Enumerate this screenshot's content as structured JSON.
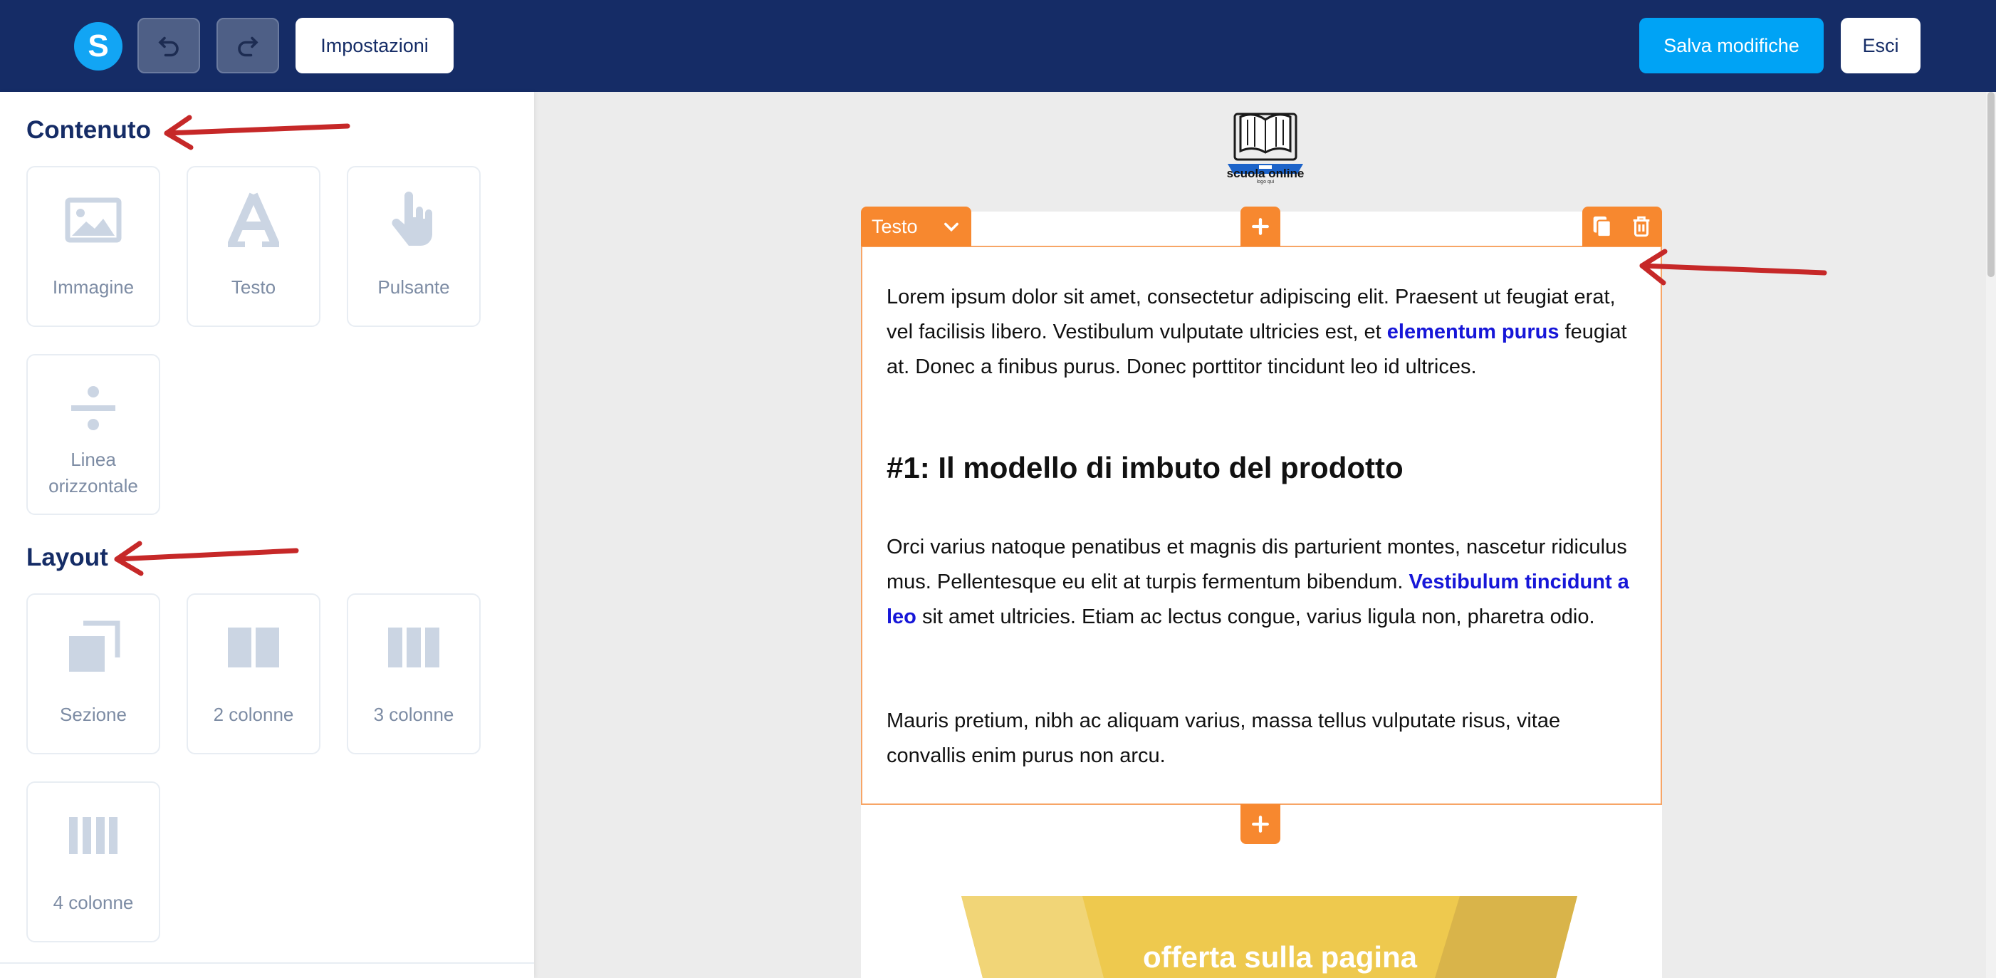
{
  "toolbar": {
    "logo_letter": "S",
    "settings_label": "Impostazioni",
    "save_label": "Salva modifiche",
    "exit_label": "Esci"
  },
  "sidebar": {
    "content_title": "Contenuto",
    "content_items": [
      {
        "label": "Immagine",
        "icon": "image-icon"
      },
      {
        "label": "Testo",
        "icon": "text-icon"
      },
      {
        "label": "Pulsante",
        "icon": "pointer-icon"
      },
      {
        "label_line1": "Linea",
        "label_line2": "orizzontale",
        "icon": "divider-icon"
      }
    ],
    "layout_title": "Layout",
    "layout_items": [
      {
        "label": "Sezione",
        "icon": "section-icon"
      },
      {
        "label": "2 colonne",
        "icon": "two-columns-icon"
      },
      {
        "label": "3 colonne",
        "icon": "three-columns-icon"
      },
      {
        "label": "4 colonne",
        "icon": "four-columns-icon"
      }
    ]
  },
  "canvas": {
    "brand_name": "scuola online",
    "brand_sub": "logo qui",
    "block_type": "Testo",
    "p1_start": "Lorem ipsum dolor sit amet, consectetur adipiscing elit. Praesent ut feugiat erat, vel facilisis libero. Vestibulum vulputate ultricies est, et ",
    "p1_link": "elementum purus",
    "p1_end": " feugiat at. Donec a finibus purus. Donec porttitor tincidunt leo id ultrices.",
    "heading": "#1: Il modello di imbuto del prodotto",
    "p2_start": "Orci varius natoque penatibus et magnis dis parturient montes, nascetur ridiculus mus. Pellentesque eu elit at turpis fermentum bibendum. ",
    "p2_link": "Vestibulum tincidunt a leo",
    "p2_end": " sit amet ultricies. Etiam ac lectus congue, varius ligula non, pharetra odio.",
    "p3": "Mauris pretium, nibh ac aliquam varius, massa tellus vulputate risus, vitae convallis enim purus non arcu.",
    "funnel_text": "offerta sulla pagina"
  },
  "colors": {
    "topbar": "#152c66",
    "accent_blue": "#00a3f5",
    "block_orange": "#f7882f",
    "link_blue": "#1616d8",
    "annotation_red": "#c62828"
  }
}
